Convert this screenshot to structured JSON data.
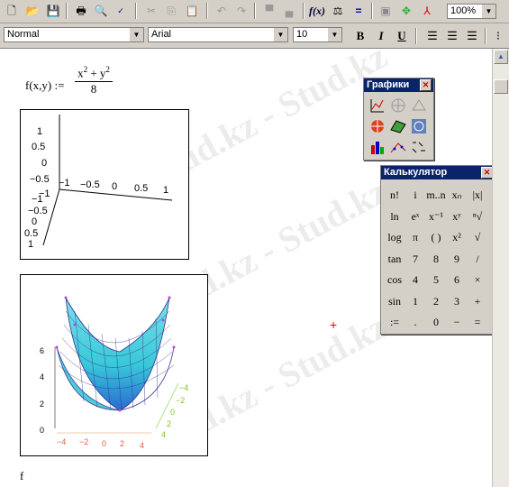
{
  "toolbar": {
    "zoom": "100%",
    "icons": [
      "new-icon",
      "open-icon",
      "save-icon",
      "print-icon",
      "print-preview-icon",
      "spellcheck-icon",
      "cut-icon",
      "copy-icon",
      "paste-icon",
      "undo-icon",
      "redo-icon",
      "align-icon",
      "insert-function-icon",
      "insert-unit-icon",
      "calculate-icon",
      "resource-icon",
      "component-icon",
      "tree-icon"
    ]
  },
  "format": {
    "style": "Normal",
    "font": "Arial",
    "size": "10",
    "bold": "B",
    "italic": "I",
    "underline": "U"
  },
  "formula": {
    "lhs": "f(x,y) :=",
    "num_a": "x",
    "num_exp1": "2",
    "num_plus": " + y",
    "num_exp2": "2",
    "den": "8"
  },
  "plot1": {
    "y_ticks": [
      "1",
      "0.5",
      "0",
      "−0.5",
      "−1"
    ],
    "x_ticks": [
      "−1",
      "−0.5",
      "0",
      "0.5",
      "1"
    ],
    "z_ticks": [
      "−1",
      "−0.5",
      "0",
      "0.5",
      "1"
    ]
  },
  "plot2": {
    "z_ticks": [
      "6",
      "4",
      "2",
      "0"
    ],
    "x_ticks": [
      "−4",
      "−2",
      "0",
      "2",
      "4"
    ],
    "y_ticks": [
      "−4",
      "−2",
      "0",
      "2",
      "4"
    ],
    "colors": {
      "surface": "#38c8d8",
      "mesh": "#303090",
      "points": "#c040e0"
    }
  },
  "graphs_palette": {
    "title": "Графики",
    "icons": [
      "xy-plot-icon",
      "polar-plot-icon",
      "surface-plot-icon",
      "contour-plot-icon",
      "3d-scatter-icon",
      "3d-bar-icon",
      "vector-field-icon",
      "plot-wizard-icon",
      "trace-icon"
    ]
  },
  "calc_palette": {
    "title": "Калькулятор",
    "keys": [
      [
        "n!",
        "i",
        "m..n",
        "xₙ",
        "|x|"
      ],
      [
        "ln",
        "eˣ",
        "x⁻¹",
        "xʸ",
        "ⁿ√"
      ],
      [
        "log",
        "π",
        "( )",
        "x²",
        "√"
      ],
      [
        "tan",
        "7",
        "8",
        "9",
        "/"
      ],
      [
        "cos",
        "4",
        "5",
        "6",
        "×"
      ],
      [
        "sin",
        "1",
        "2",
        "3",
        "+"
      ],
      [
        ":=",
        ".",
        "0",
        "−",
        "="
      ]
    ]
  },
  "watermark": "Stud.kz - Stud.kz",
  "doc_text": "f"
}
